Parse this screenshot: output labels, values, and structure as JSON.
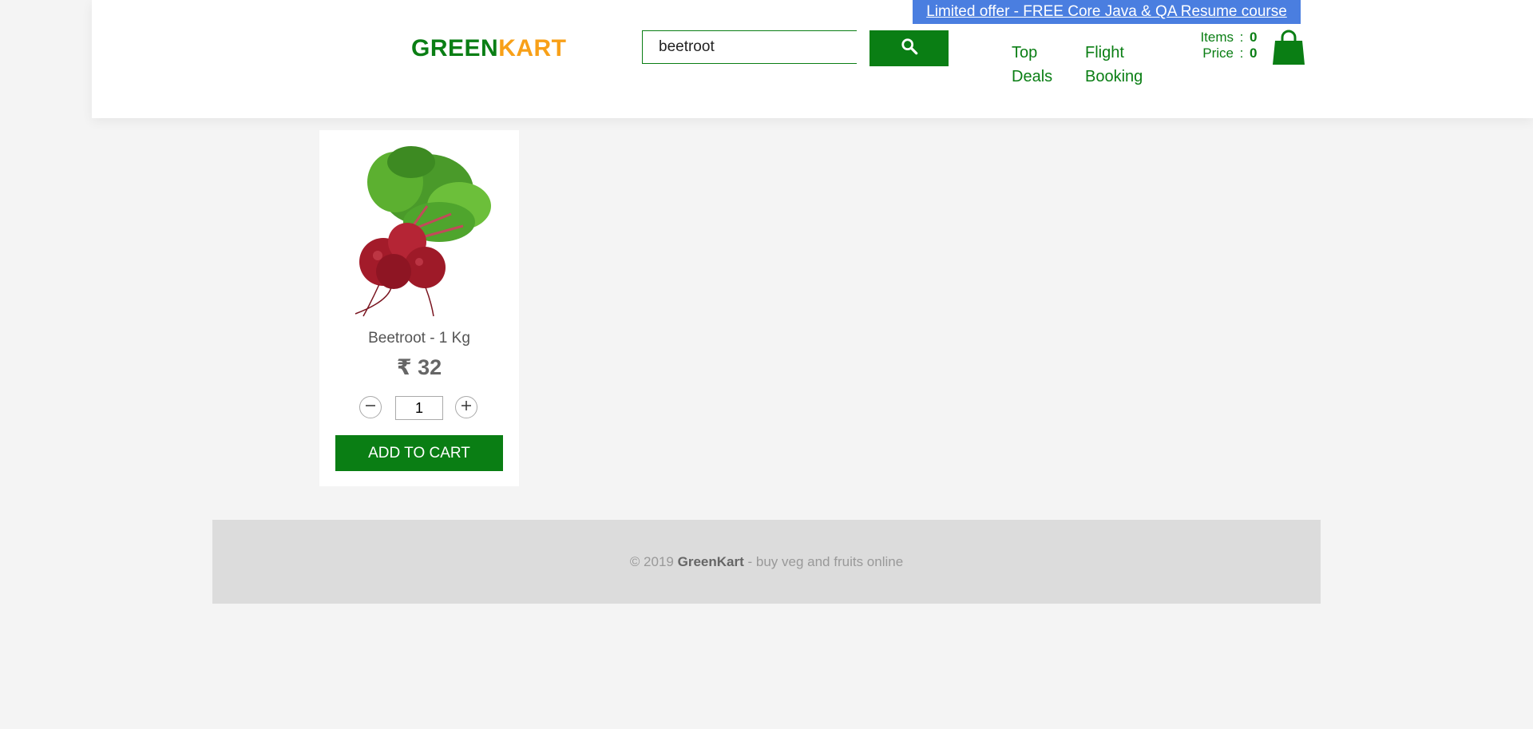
{
  "header": {
    "offer_link": "Limited offer - FREE Core Java & QA Resume course",
    "brand_green": "GREEN",
    "brand_kart": "KART",
    "search": {
      "value": "beetroot",
      "placeholder": ""
    },
    "nav": {
      "top_deals": "Top Deals",
      "flight_booking": "Flight Booking"
    },
    "cart_info": {
      "items_label": "Items",
      "items_value": "0",
      "price_label": "Price",
      "price_value": "0",
      "separator": ":"
    }
  },
  "products": [
    {
      "name": "Beetroot - 1 Kg",
      "price": "₹ 32",
      "quantity": "1",
      "add_label": "ADD TO CART"
    }
  ],
  "footer": {
    "copyright": "© 2019",
    "brand": "GreenKart",
    "tagline": "- buy veg and fruits online"
  },
  "colors": {
    "brand_green": "#0a7e14",
    "brand_orange": "#f8a018",
    "offer_bg": "#4a7ee0",
    "page_bg": "#f4f4f4"
  },
  "icons": [
    "search-icon",
    "shopping-bag-icon",
    "minus-icon",
    "plus-icon"
  ]
}
